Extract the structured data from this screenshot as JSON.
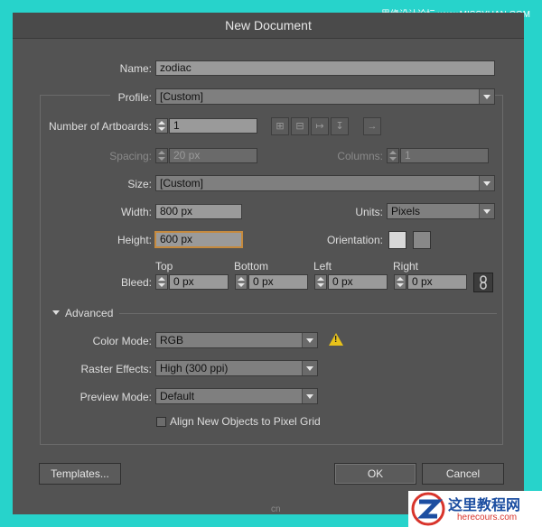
{
  "dialog": {
    "title": "New Document",
    "name_label": "Name:",
    "name_value": "zodiac",
    "profile_label": "Profile:",
    "profile_value": "[Custom]",
    "artboards_label": "Number of Artboards:",
    "artboards_value": "1",
    "spacing_label": "Spacing:",
    "spacing_value": "20 px",
    "columns_label": "Columns:",
    "columns_value": "1",
    "size_label": "Size:",
    "size_value": "[Custom]",
    "width_label": "Width:",
    "width_value": "800 px",
    "units_label": "Units:",
    "units_value": "Pixels",
    "height_label": "Height:",
    "height_value": "600 px",
    "orientation_label": "Orientation:",
    "bleed_label": "Bleed:",
    "bleed_top_label": "Top",
    "bleed_top_value": "0 px",
    "bleed_bottom_label": "Bottom",
    "bleed_bottom_value": "0 px",
    "bleed_left_label": "Left",
    "bleed_left_value": "0 px",
    "bleed_right_label": "Right",
    "bleed_right_value": "0 px",
    "advanced_label": "Advanced",
    "color_mode_label": "Color Mode:",
    "color_mode_value": "RGB",
    "raster_label": "Raster Effects:",
    "raster_value": "High (300 ppi)",
    "preview_label": "Preview Mode:",
    "preview_value": "Default",
    "align_label": "Align New Objects to Pixel Grid",
    "templates_button": "Templates...",
    "ok_button": "OK",
    "cancel_button": "Cancel"
  },
  "watermark": {
    "top_text": "思缘设计论坛 www.MISSYUAN.COM",
    "logo_text": "这里教程网",
    "logo_url_text": "herecours.com",
    "center_text": "cn"
  },
  "colors": {
    "frame": "#27d3cb",
    "panel": "#535353",
    "field_bg": "#9a9a9a",
    "focus": "#c58a3e",
    "warning": "#e8c21a"
  },
  "icons": [
    "arrange-by-grid-icon",
    "arrange-by-row-icon",
    "arrange-by-column-icon",
    "arrange-column-icon",
    "layout-direction-icon",
    "portrait-icon",
    "landscape-icon",
    "link-icon",
    "warning-icon",
    "disclosure-triangle-icon"
  ]
}
